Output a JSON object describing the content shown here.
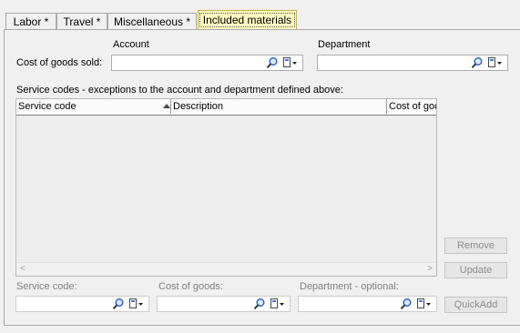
{
  "tabs": [
    {
      "label": "Labor *",
      "active": false
    },
    {
      "label": "Travel *",
      "active": false
    },
    {
      "label": "Miscellaneous *",
      "active": false
    },
    {
      "label": "Included materials",
      "active": true
    }
  ],
  "cogs": {
    "account_header": "Account",
    "department_header": "Department",
    "row_label": "Cost of goods sold:",
    "account_value": "",
    "department_value": ""
  },
  "exceptions": {
    "section_label": "Service codes - exceptions to the account and department defined above:",
    "columns": [
      "Service code",
      "Description",
      "Cost of goods"
    ],
    "sort_column": "Service code",
    "rows": []
  },
  "buttons": {
    "remove": "Remove",
    "update": "Update",
    "quickadd": "QuickAdd"
  },
  "entry": {
    "service_code_label": "Service code:",
    "cost_of_goods_label": "Cost of goods:",
    "department_label": "Department - optional:",
    "service_code_value": "",
    "cost_of_goods_value": "",
    "department_value": ""
  },
  "icons": {
    "lookup": "magnifier-icon",
    "select": "dropdown-select-icon"
  },
  "colors": {
    "active_tab": "#fff9c0",
    "background": "#f0f0f0",
    "disabled_text": "#8c8c8c"
  }
}
